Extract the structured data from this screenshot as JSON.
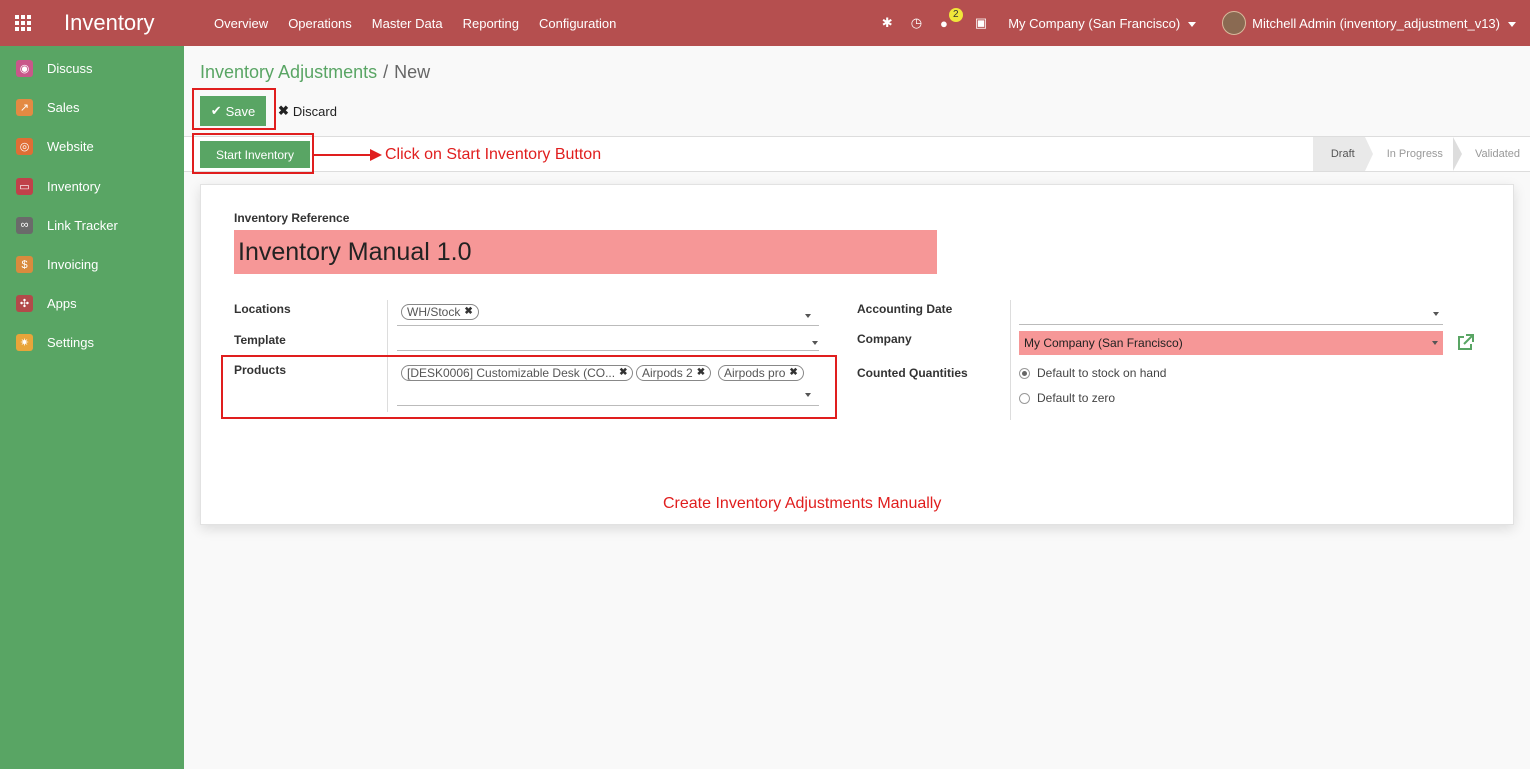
{
  "topbar": {
    "app_title": "Inventory",
    "menu": [
      "Overview",
      "Operations",
      "Master Data",
      "Reporting",
      "Configuration"
    ],
    "chat_count": "2",
    "company": "My Company (San Francisco)",
    "user": "Mitchell Admin (inventory_adjustment_v13)"
  },
  "sidebar": {
    "items": [
      {
        "label": "Discuss",
        "icon": "chat-icon",
        "color": "#c9578a"
      },
      {
        "label": "Sales",
        "icon": "chart-icon",
        "color": "#e38a43"
      },
      {
        "label": "Website",
        "icon": "globe-icon",
        "color": "#e06e35"
      },
      {
        "label": "Inventory",
        "icon": "box-icon",
        "color": "#c0414a"
      },
      {
        "label": "Link Tracker",
        "icon": "link-icon",
        "color": "#6a6a6a"
      },
      {
        "label": "Invoicing",
        "icon": "invoice-icon",
        "color": "#d98b3e"
      },
      {
        "label": "Apps",
        "icon": "apps-icon",
        "color": "#b24a4a"
      },
      {
        "label": "Settings",
        "icon": "gear-icon",
        "color": "#e8a53a"
      }
    ]
  },
  "breadcrumb": {
    "parent": "Inventory Adjustments",
    "separator": "/",
    "current": "New"
  },
  "buttons": {
    "save": "Save",
    "discard": "Discard",
    "start_inventory": "Start Inventory"
  },
  "stages": [
    "Draft",
    "In Progress",
    "Validated"
  ],
  "form": {
    "reference_label": "Inventory Reference",
    "reference_value": "Inventory Manual 1.0",
    "locations_label": "Locations",
    "locations_tags": [
      "WH/Stock"
    ],
    "template_label": "Template",
    "template_value": "",
    "products_label": "Products",
    "products_tags": [
      "[DESK0006] Customizable Desk (CO...",
      "Airpods 2",
      "Airpods pro"
    ],
    "accounting_date_label": "Accounting Date",
    "accounting_date_value": "",
    "company_label": "Company",
    "company_value": "My Company (San Francisco)",
    "counted_label": "Counted Quantities",
    "counted_options": [
      "Default to stock on hand",
      "Default to zero"
    ],
    "counted_selected": "Default to stock on hand"
  },
  "annotations": {
    "start_hint": "Click on Start Inventory Button",
    "bottom_note": "Create Inventory Adjustments Manually"
  },
  "colors": {
    "topbar": "#b54f4f",
    "sidebar": "#59a564",
    "primary": "#59a564",
    "required": "#f69797",
    "annotation": "#e01e1e"
  }
}
